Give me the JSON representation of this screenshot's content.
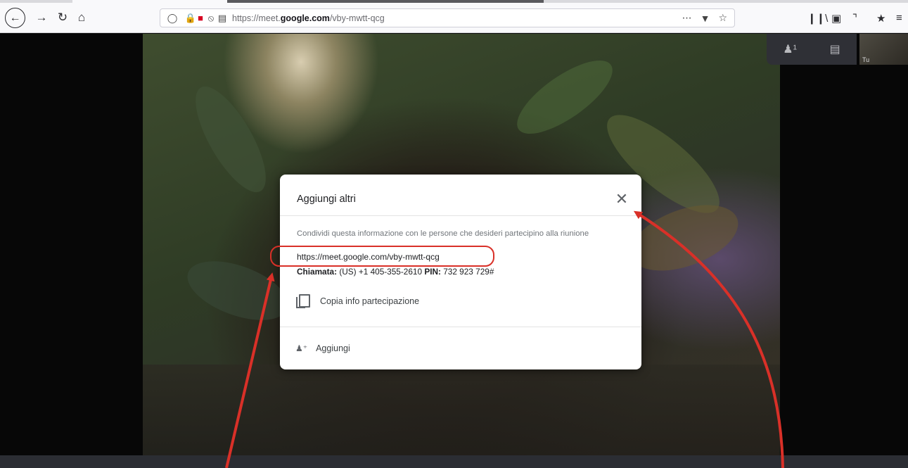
{
  "browser": {
    "url_prefix": "https://meet.",
    "url_domain": "google.com",
    "url_path": "/vby-mwtt-qcg",
    "icons": {
      "back": "back-arrow-icon",
      "forward": "forward-arrow-icon",
      "reload": "reload-icon",
      "home": "home-icon",
      "shield": "tracking-shield-icon",
      "lock": "lock-icon",
      "camera": "camera-icon",
      "mic": "microphone-muted-icon",
      "chat": "notification-icon",
      "more": "more-actions-icon",
      "pocket": "pocket-icon",
      "bookmark": "bookmark-star-icon",
      "library": "library-icon",
      "sidebar": "sidebar-icon",
      "account": "account-icon",
      "extension": "extension-icon",
      "menu": "hamburger-menu-icon"
    }
  },
  "meet": {
    "self_label": "Tu",
    "icons": {
      "people": "people-icon",
      "chat": "chat-icon"
    }
  },
  "dialog": {
    "title": "Aggiungi altri",
    "description": "Condividi questa informazione con le persone che desideri partecipino alla riunione",
    "link": "https://meet.google.com/vby-mwtt-qcg",
    "dial_label": "Chiamata:",
    "dial_number": " (US) +1 405-355-2610 ",
    "pin_label": " PIN:",
    "pin_value": " 732 923 729#",
    "copy_label": "Copia info partecipazione",
    "add_label": "Aggiungi"
  },
  "colors": {
    "annotation": "#d93028",
    "dialog_bg": "#ffffff",
    "toolbar_bg": "#f9f9fb"
  }
}
